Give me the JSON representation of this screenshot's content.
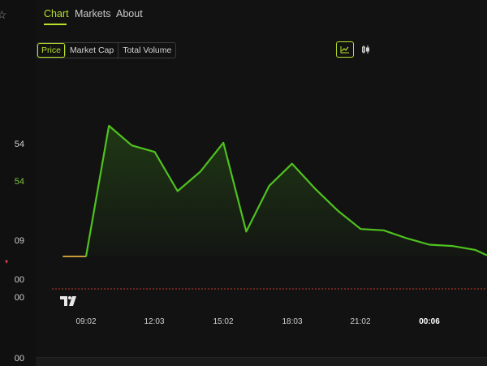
{
  "left_values": [
    {
      "text": "54",
      "color": "#d0d0d0"
    },
    {
      "text": "54",
      "color": "#7ec63a"
    },
    {
      "text": "09",
      "color": "#d0d0d0"
    },
    {
      "text": "▾",
      "color": "#e04444"
    },
    {
      "text": "00",
      "color": "#d0d0d0"
    },
    {
      "text": "00",
      "color": "#d0d0d0"
    },
    {
      "text": "00",
      "color": "#d0d0d0"
    }
  ],
  "tabs": [
    {
      "label": "Chart",
      "active": true
    },
    {
      "label": "Markets",
      "active": false
    },
    {
      "label": "About",
      "active": false
    }
  ],
  "metric_options": [
    {
      "label": "Price",
      "active": true
    },
    {
      "label": "Market Cap",
      "active": false
    },
    {
      "label": "Total Volume",
      "active": false
    }
  ],
  "chart_modes": [
    {
      "icon": "line-chart-icon",
      "active": true
    },
    {
      "icon": "candlestick-icon",
      "active": false
    }
  ],
  "colors": {
    "accent": "#b7e22a",
    "line": "#4fc21f",
    "early_segment": "#c89a3a",
    "reference_line": "#c0392b"
  },
  "chart_data": {
    "type": "area",
    "title": "",
    "xlabel": "",
    "ylabel": "",
    "x_ticks": [
      {
        "label": "09:02",
        "bold": false
      },
      {
        "label": "12:03",
        "bold": false
      },
      {
        "label": "15:02",
        "bold": false
      },
      {
        "label": "18:03",
        "bold": false
      },
      {
        "label": "21:02",
        "bold": false
      },
      {
        "label": "00:06",
        "bold": true
      }
    ],
    "x_hours": [
      8.0,
      9.0,
      10.0,
      11.0,
      12.0,
      13.0,
      14.0,
      15.0,
      16.0,
      17.0,
      18.0,
      19.0,
      20.0,
      21.0,
      22.0,
      23.0,
      24.0,
      25.0,
      26.0,
      26.5
    ],
    "values": [
      0,
      0,
      100,
      85,
      80,
      50,
      65,
      87,
      19,
      54,
      71,
      52,
      35,
      21,
      20,
      14,
      9,
      8,
      5,
      1
    ],
    "ylim": [
      -26,
      110
    ],
    "reference_value": -26,
    "grid": false
  }
}
